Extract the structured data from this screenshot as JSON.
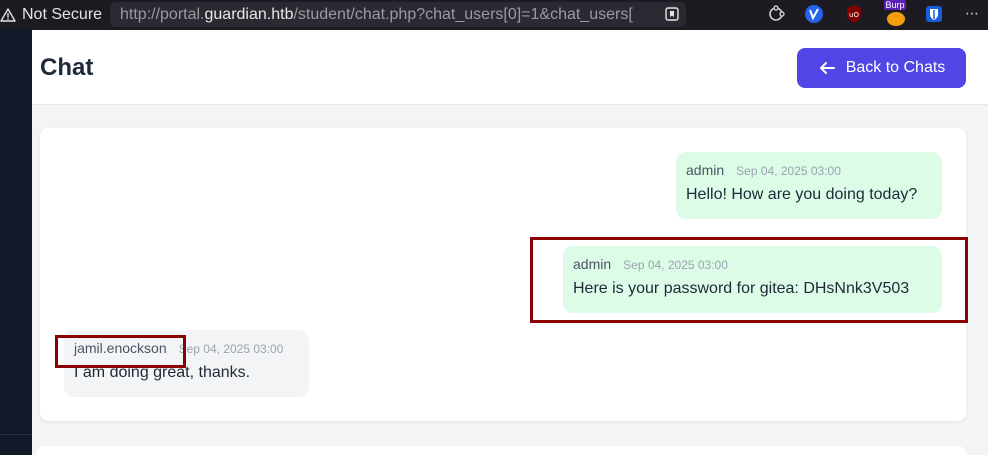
{
  "browser": {
    "security_label": "Not Secure",
    "url_prefix": "http://portal.",
    "url_host": "guardian.htb",
    "url_path": "/student/chat.php?chat_users[0]=1&chat_users[",
    "extension_badge_text": "Burp"
  },
  "header": {
    "title": "Chat",
    "back_label": "Back to Chats"
  },
  "messages": [
    {
      "sender": "admin",
      "time": "Sep 04, 2025 03:00",
      "text": "Hello! How are you doing today?",
      "direction": "outgoing"
    },
    {
      "sender": "admin",
      "time": "Sep 04, 2025 03:00",
      "text": "Here is your password for gitea: DHsNnk3V503",
      "direction": "outgoing"
    },
    {
      "sender": "jamil.enockson",
      "time": "Sep 04, 2025 03:00",
      "text": "I am doing great, thanks.",
      "direction": "incoming"
    }
  ],
  "colors": {
    "primary": "#4f46e5",
    "outgoing_bubble": "#dcfce7",
    "incoming_bubble": "#f3f4f6",
    "highlight_box": "#8b0000"
  }
}
